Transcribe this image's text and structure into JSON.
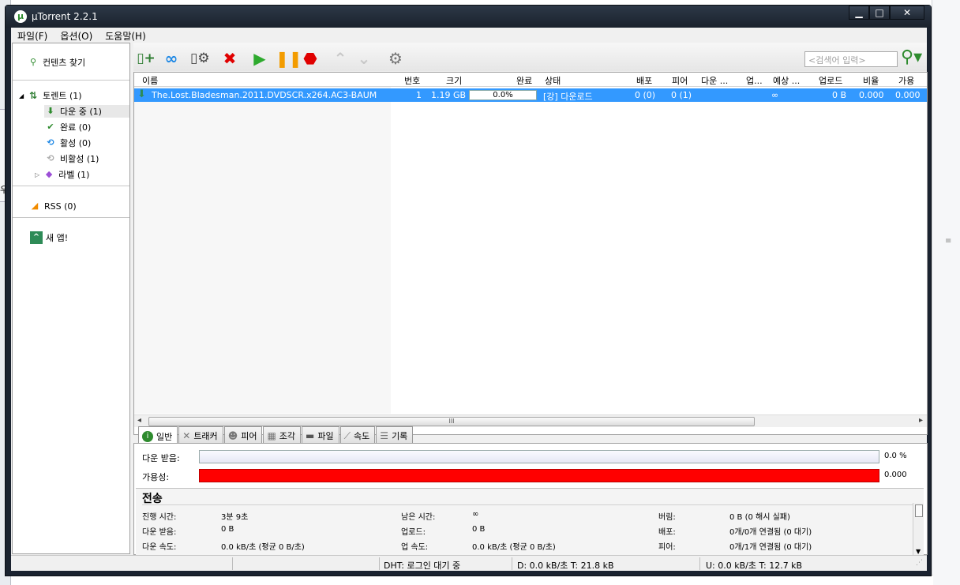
{
  "window": {
    "title": "µTorrent 2.2.1",
    "logo": "µ"
  },
  "menu": {
    "file": "파일(F)",
    "options": "옵션(O)",
    "help": "도움말(H)"
  },
  "sidebar": {
    "find_content": "컨텐츠 찾기",
    "torrents": "토렌트 (1)",
    "downloading": "다운 중 (1)",
    "completed": "완료 (0)",
    "active": "활성 (0)",
    "inactive": "비활성 (1)",
    "labels": "라벨 (1)",
    "rss": "RSS (0)",
    "new_app": "새 앱!"
  },
  "toolbar": {
    "search_placeholder": "<검색어 입력>"
  },
  "columns": {
    "name": "이름",
    "number": "번호",
    "size": "크기",
    "done": "완료",
    "status": "상태",
    "seeds": "배포",
    "peers": "피어",
    "down": "다운 ...",
    "up": "업...",
    "eta": "예상 ...",
    "uploaded": "업로드",
    "ratio": "비율",
    "avail": "가용"
  },
  "torrent": {
    "name": "The.Lost.Bladesman.2011.DVDSCR.x264.AC3-BAUM",
    "number": "1",
    "size": "1.19 GB",
    "done": "0.0%",
    "done_fraction": 0.0,
    "status": "[강] 다운로드",
    "seeds": "0 (0)",
    "peers": "0 (1)",
    "eta": "∞",
    "uploaded": "0 B",
    "ratio": "0.000",
    "avail": "0.000"
  },
  "hscroll_grip": "III",
  "tabs": {
    "general": "일반",
    "trackers": "트래커",
    "peers": "피어",
    "pieces": "조각",
    "files": "파일",
    "speed": "속도",
    "log": "기록"
  },
  "general": {
    "downloaded_label": "다운 받음:",
    "downloaded_pct": "0.0 %",
    "availability_label": "가용성:",
    "availability_value": "0.000"
  },
  "transfer": {
    "heading": "전송",
    "time_elapsed_label": "진행 시간:",
    "time_elapsed": "3분 9초",
    "remaining_label": "남은 시간:",
    "remaining": "∞",
    "wasted_label": "버림:",
    "wasted": "0 B (0 해시 실패)",
    "downloaded_label": "다운 받음:",
    "downloaded": "0 B",
    "uploaded_label": "업로드:",
    "uploaded": "0 B",
    "seeds_label": "배포:",
    "seeds": "0개/0개 연결됨 (0 대기)",
    "dl_speed_label": "다운 속도:",
    "dl_speed": "0.0 kB/초 (평균 0 B/초)",
    "ul_speed_label": "업 속도:",
    "ul_speed": "0.0 kB/초 (평균 0 B/초)",
    "peers_label": "피어:",
    "peers": "0개/1개 연결됨 (0 대기)"
  },
  "statusbar": {
    "dht": "DHT: 로그인 대기 중",
    "down": "D: 0.0 kB/초 T: 21.8 kB",
    "up": "U: 0.0 kB/초 T: 12.7 kB"
  },
  "background": {
    "left_char": "우"
  }
}
